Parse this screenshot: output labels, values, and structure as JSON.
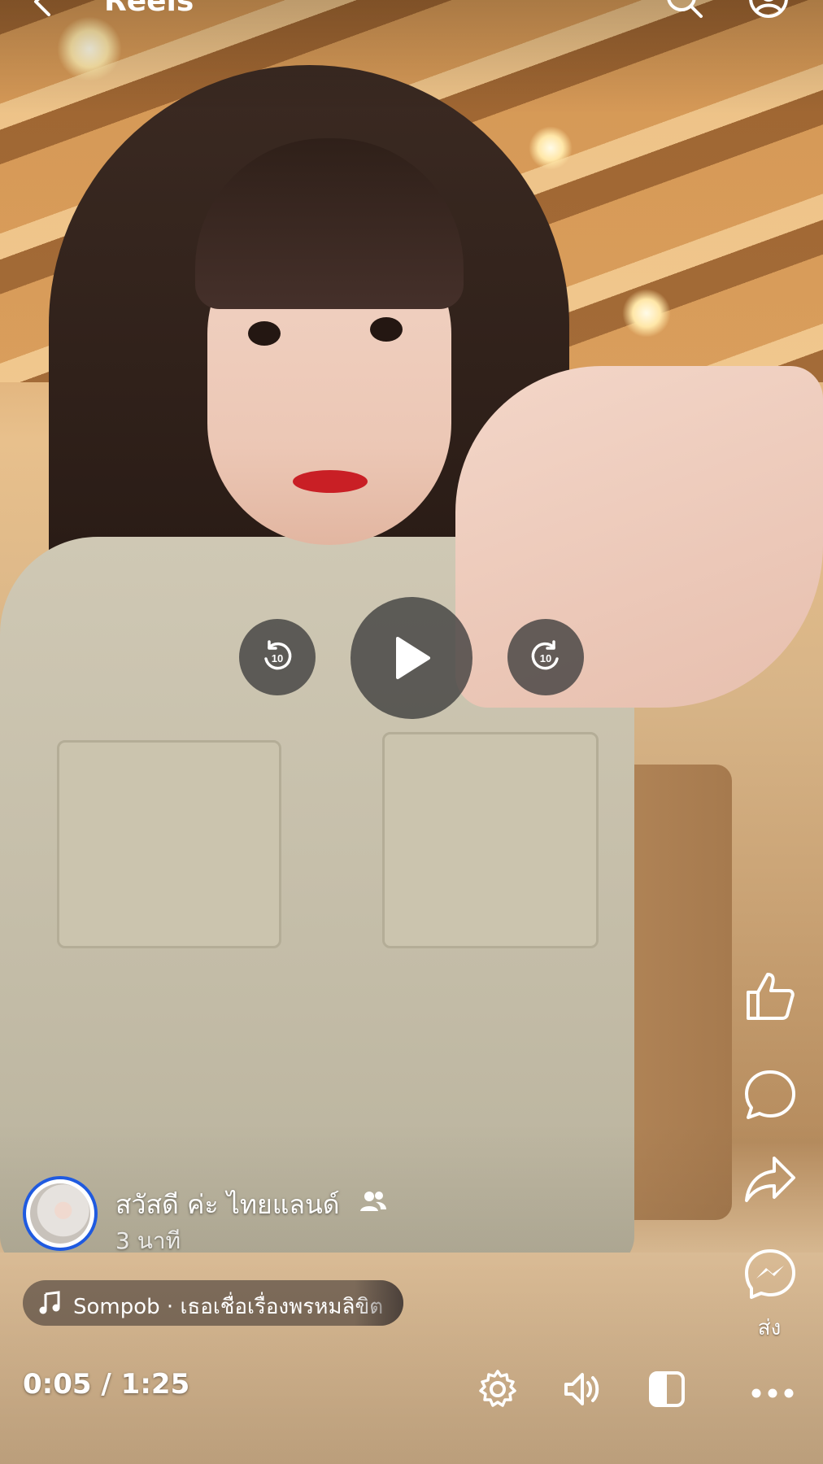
{
  "topbar": {
    "title": "Reels"
  },
  "player": {
    "rewind_label": "10",
    "forward_label": "10"
  },
  "rail": {
    "share_label": "ส่ง"
  },
  "author": {
    "name": "สวัสดี ค่ะ ไทยแลนด์",
    "posted": "3 นาที"
  },
  "music": {
    "text": "Sompob · เธอเชื่อเรื่องพรหมลิขิต"
  },
  "playback": {
    "time": "0:05 / 1:25"
  },
  "icons": {
    "back": "chevron-left-icon",
    "title_dropdown": "chevron-down-icon",
    "search": "search-icon",
    "profile": "profile-icon",
    "rewind": "rewind-10-icon",
    "play": "play-icon",
    "forward": "forward-10-icon",
    "like": "like-icon",
    "comment": "comment-icon",
    "share": "share-icon",
    "messenger": "messenger-icon",
    "friends": "friends-icon",
    "music": "music-note-icon",
    "settings": "gear-icon",
    "volume": "volume-icon",
    "captions": "half-square-icon",
    "more": "more-icon"
  },
  "colors": {
    "avatar_ring": "#1f5ae0",
    "overlay_text": "#ffffff"
  }
}
